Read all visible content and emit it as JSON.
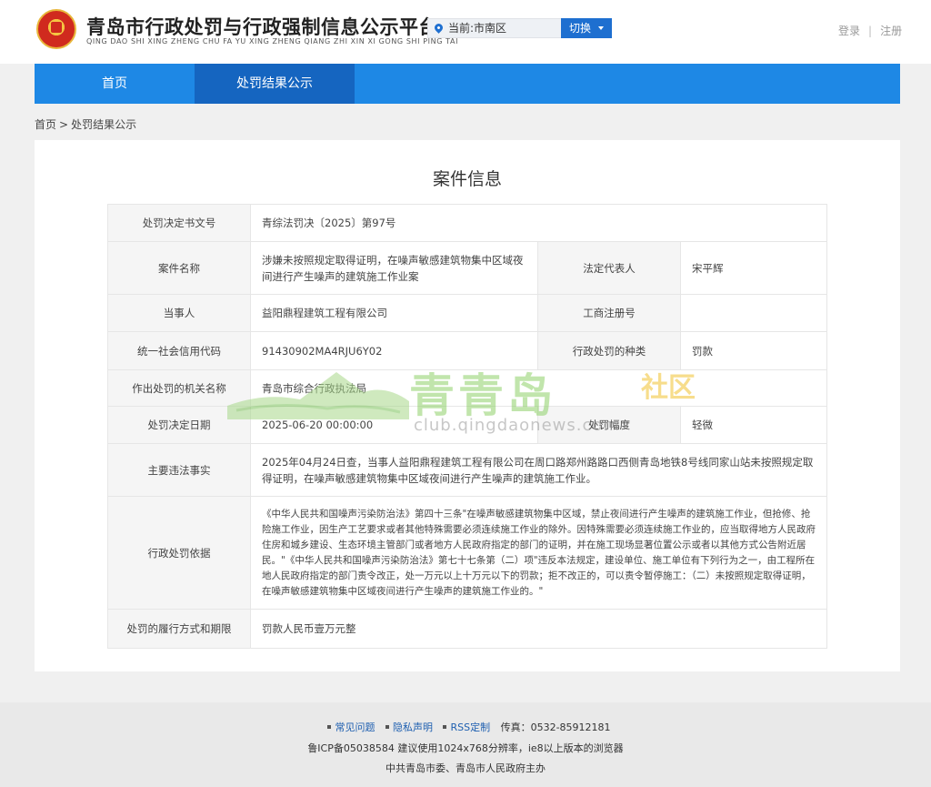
{
  "header": {
    "title": "青岛市行政处罚与行政强制信息公示平台",
    "subtitle": "QING DAO SHI XING ZHENG CHU FA YU XING ZHENG QIANG ZHI XIN XI GONG SHI PING TAI",
    "location": "当前:市南区",
    "switch_label": "切换",
    "login": "登录",
    "separator": "|",
    "register": "注册"
  },
  "nav": {
    "home": "首页",
    "active": "处罚结果公示"
  },
  "breadcrumb": {
    "home": "首页",
    "arrow": ">",
    "current": "处罚结果公示"
  },
  "case": {
    "title": "案件信息",
    "rows": {
      "doc_no_label": "处罚决定书文号",
      "doc_no": "青综法罚决〔2025〕第97号",
      "case_name_label": "案件名称",
      "case_name": "涉嫌未按照规定取得证明，在噪声敏感建筑物集中区域夜间进行产生噪声的建筑施工作业案",
      "legal_rep_label": "法定代表人",
      "legal_rep": "宋平辉",
      "party_label": "当事人",
      "party": "益阳鼎程建筑工程有限公司",
      "biz_reg_label": "工商注册号",
      "biz_reg": "",
      "credit_code_label": "统一社会信用代码",
      "credit_code": "91430902MA4RJU6Y02",
      "penalty_type_label": "行政处罚的种类",
      "penalty_type": "罚款",
      "authority_label": "作出处罚的机关名称",
      "authority": "青岛市综合行政执法局",
      "decision_date_label": "处罚决定日期",
      "decision_date": "2025-06-20 00:00:00",
      "penalty_range_label": "处罚幅度",
      "penalty_range": "轻微",
      "facts_label": "主要违法事实",
      "facts": "2025年04月24日查，当事人益阳鼎程建筑工程有限公司在周口路郑州路路口西侧青岛地铁8号线同家山站未按照规定取得证明，在噪声敏感建筑物集中区域夜间进行产生噪声的建筑施工作业。",
      "basis_label": "行政处罚依据",
      "basis": "《中华人民共和国噪声污染防治法》第四十三条\"在噪声敏感建筑物集中区域，禁止夜间进行产生噪声的建筑施工作业，但抢修、抢险施工作业，因生产工艺要求或者其他特殊需要必须连续施工作业的除外。因特殊需要必须连续施工作业的，应当取得地方人民政府住房和城乡建设、生态环境主管部门或者地方人民政府指定的部门的证明，并在施工现场显著位置公示或者以其他方式公告附近居民。\"《中华人民共和国噪声污染防治法》第七十七条第（二）项\"违反本法规定，建设单位、施工单位有下列行为之一，由工程所在地人民政府指定的部门责令改正，处一万元以上十万元以下的罚款；拒不改正的，可以责令暂停施工：（二）未按照规定取得证明，在噪声敏感建筑物集中区域夜间进行产生噪声的建筑施工作业的。\"",
      "method_label": "处罚的履行方式和期限",
      "method": "罚款人民币壹万元整"
    }
  },
  "watermark": {
    "main": "青青岛",
    "community": "社区",
    "url": "club.qingdaonews.com"
  },
  "footer": {
    "faq": "常见问题",
    "privacy": "隐私声明",
    "rss": "RSS定制",
    "fax": "传真：0532-85912181",
    "icp": "鲁ICP备05038584 建议使用1024x768分辨率，ie8以上版本的浏览器",
    "host": "中共青岛市委、青岛市人民政府主办"
  },
  "colors": {
    "nav": "#1e88e5",
    "nav_active": "#1565c0",
    "accent": "#1e6fd0"
  }
}
